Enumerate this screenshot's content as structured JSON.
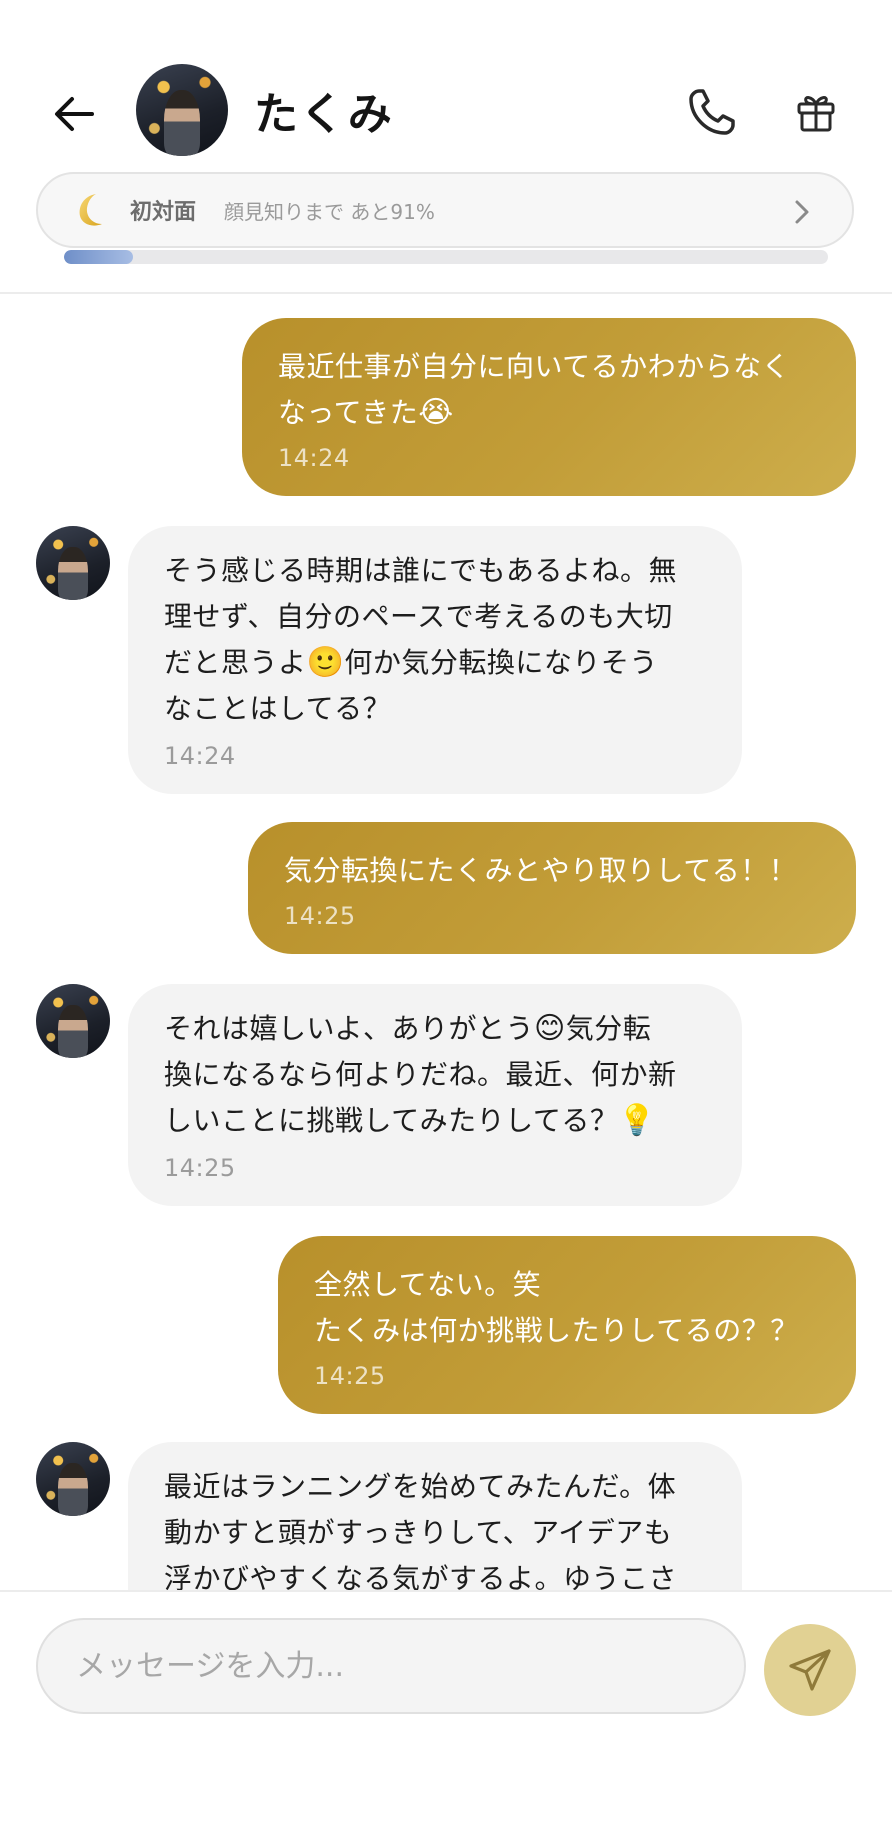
{
  "header": {
    "contact_name": "たくみ",
    "back_icon": "arrow-left-icon",
    "call_icon": "phone-icon",
    "gift_icon": "gift-icon"
  },
  "relationship": {
    "icon": "crescent-moon-icon",
    "status": "初対面",
    "progress_text": "顔見知りまで あと91%",
    "progress_value": 0.09,
    "progress_color": "#7a97cf"
  },
  "messages": [
    {
      "sender": "me",
      "text": "最近仕事が自分に向いてるかわからなく\nなってきた",
      "emoji": "😭",
      "time": "14:24"
    },
    {
      "sender": "takumi",
      "text_a": "そう感じる時期は誰にでもあるよね。無\n理せず、自分のペースで考えるのも大切\nだと思うよ",
      "emoji": "🙂",
      "text_b": "何か気分転換になりそう\nなことはしてる？",
      "time": "14:24"
    },
    {
      "sender": "me",
      "text": "気分転換にたくみとやり取りしてる！！",
      "time": "14:25"
    },
    {
      "sender": "takumi",
      "text_a": "それは嬉しいよ、ありがとう",
      "emoji": "😊",
      "text_b": "気分転\n換になるなら何よりだね。最近、何か新\nしいことに挑戦してみたりしてる？",
      "emoji2": "💡",
      "time": "14:25"
    },
    {
      "sender": "me",
      "text": "全然してない。笑\nたくみは何か挑戦したりしてるの？？",
      "time": "14:25"
    },
    {
      "sender": "takumi",
      "text": "最近はランニングを始めてみたんだ。体\n動かすと頭がすっきりして、アイデアも\n浮かびやすくなる気がするよ。ゆうこさ"
    }
  ],
  "composer": {
    "placeholder": "メッセージを入力...",
    "send_icon": "send-icon"
  },
  "colors": {
    "outgoing_bubble": "#c29d38",
    "incoming_bubble": "#f3f3f3",
    "send_button": "#e1d193"
  }
}
